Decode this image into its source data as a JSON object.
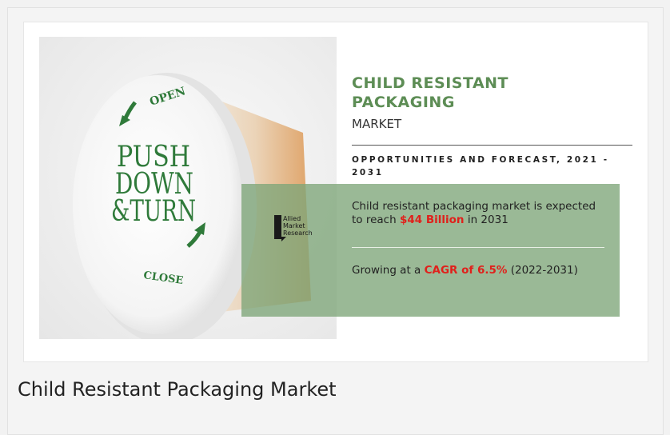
{
  "infographic": {
    "title": "CHILD RESISTANT PACKAGING",
    "subtitle": "MARKET",
    "forecast_label": "OPPORTUNITIES AND FORECAST, 2021 - 2031",
    "stat1": {
      "prefix": "Child resistant packaging market is expected to reach ",
      "highlight": "$44 Billion",
      "suffix": " in 2031"
    },
    "stat2": {
      "prefix": "Growing at a ",
      "highlight": "CAGR of 6.5%",
      "suffix": " (2022-2031)"
    },
    "logo": {
      "line1": "Allied",
      "line2": "Market",
      "line3": "Research"
    },
    "cap_text": {
      "open": "OPEN",
      "line1": "PUSH",
      "line2": "DOWN",
      "line3": "&TURN",
      "close": "CLOSE"
    },
    "colors": {
      "title_green": "#5d8d55",
      "panel_green": "#7ea578",
      "highlight_red": "#e0201b"
    }
  },
  "caption": "Child Resistant Packaging Market"
}
